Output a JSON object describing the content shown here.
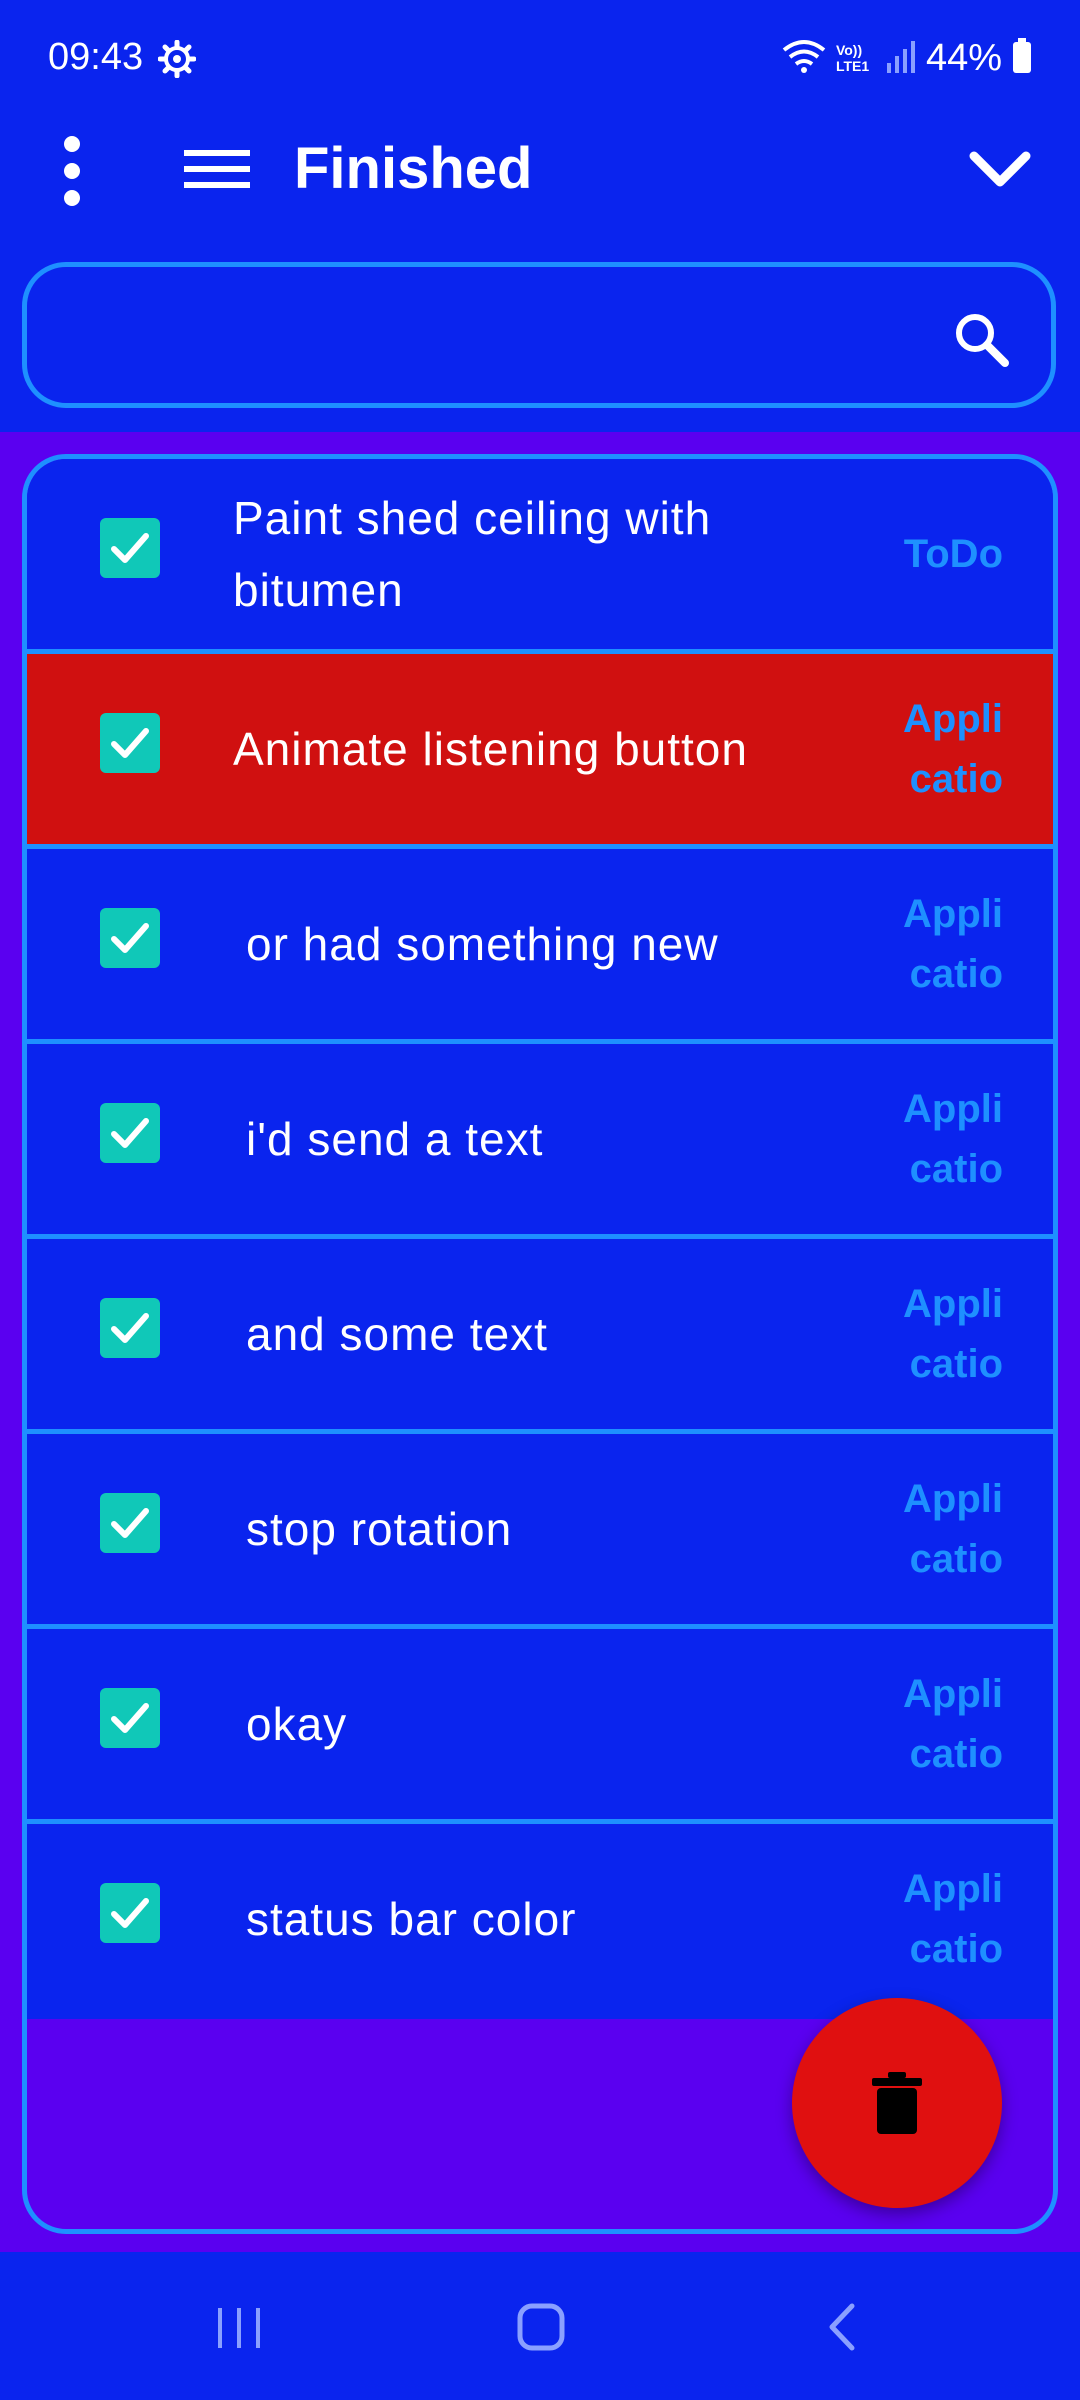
{
  "status_bar": {
    "time": "09:43",
    "network_label": "Vo)) LTE1",
    "battery": "44%"
  },
  "app_bar": {
    "title": "Finished"
  },
  "search": {
    "value": "",
    "placeholder": ""
  },
  "tasks": [
    {
      "text": "Paint shed ceiling with bitumen",
      "tag": "ToDo",
      "checked": true,
      "selected": false
    },
    {
      "text": "Animate listening button",
      "tag": "Appli catio",
      "checked": true,
      "selected": true
    },
    {
      "text": "or had something new",
      "tag": "Appli catio",
      "checked": true,
      "selected": false
    },
    {
      "text": "i'd send a text",
      "tag": "Appli catio",
      "checked": true,
      "selected": false
    },
    {
      "text": "and some text",
      "tag": "Appli catio",
      "checked": true,
      "selected": false
    },
    {
      "text": "stop rotation",
      "tag": "Appli catio",
      "checked": true,
      "selected": false
    },
    {
      "text": "okay",
      "tag": "Appli catio",
      "checked": true,
      "selected": false
    },
    {
      "text": "status bar color",
      "tag": "Appli catio",
      "checked": true,
      "selected": false
    }
  ],
  "colors": {
    "background": "#0a24ee",
    "content_background": "#5a00f0",
    "accent": "#1e90ff",
    "selected_row": "#d01010",
    "checkbox": "#10c8b8",
    "fab": "#e01010"
  },
  "icons": {
    "status": [
      "gear-icon",
      "wifi-icon",
      "signal-icon",
      "battery-icon"
    ],
    "app_bar": [
      "more-vert-icon",
      "menu-icon",
      "chevron-down-icon"
    ],
    "search": "search-icon",
    "fab": "trash-icon",
    "nav": [
      "recent-apps-icon",
      "home-icon",
      "back-icon"
    ]
  }
}
